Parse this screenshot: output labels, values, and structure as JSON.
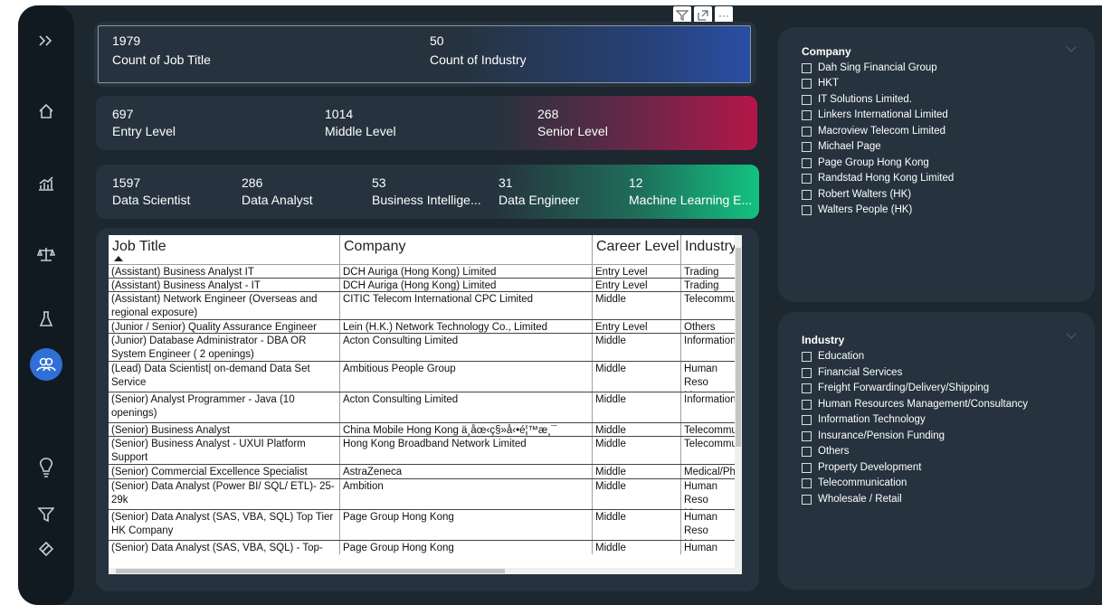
{
  "kpis": {
    "row1": [
      {
        "value": "1979",
        "label": "Count of Job Title"
      },
      {
        "value": "50",
        "label": "Count of Industry"
      }
    ],
    "row2": [
      {
        "value": "697",
        "label": "Entry Level"
      },
      {
        "value": "1014",
        "label": "Middle Level"
      },
      {
        "value": "268",
        "label": "Senior Level"
      }
    ],
    "row3": [
      {
        "value": "1597",
        "label": "Data Scientist"
      },
      {
        "value": "286",
        "label": "Data Analyst"
      },
      {
        "value": "53",
        "label": "Business Intellige..."
      },
      {
        "value": "31",
        "label": "Data Engineer"
      },
      {
        "value": "12",
        "label": "Machine Learning E..."
      }
    ]
  },
  "visual_header": {
    "more_label": "···"
  },
  "table": {
    "headers": [
      "Job Title",
      "Company",
      "Career Level",
      "Industry"
    ],
    "rows": [
      [
        "(Assistant) Business Analyst IT",
        "DCH Auriga (Hong Kong) Limited",
        "Entry Level",
        "Trading and"
      ],
      [
        "(Assistant) Business Analyst - IT",
        "DCH Auriga (Hong Kong) Limited",
        "Entry Level",
        "Trading and"
      ],
      [
        "(Assistant) Network Engineer (Overseas and regional exposure)",
        "CITIC Telecom International CPC Limited",
        "Middle",
        "Telecommu"
      ],
      [
        "(Junior / Senior) Quality Assurance Engineer",
        "Lein (H.K.) Network Technology Co., Limited",
        "Entry Level",
        "Others"
      ],
      [
        "(Junior) Database Administrator - DBA OR System Engineer ( 2 openings)",
        "Acton Consulting Limited",
        "Middle",
        "Information"
      ],
      [
        "(Lead) Data Scientist| on-demand Data Set Service",
        "Ambitious People Group",
        "Middle",
        "Human Reso Manageme"
      ],
      [
        "(Senior) Analyst Programmer - Java (10 openings)",
        "Acton Consulting Limited",
        "Middle",
        "Information"
      ],
      [
        "(Senior) Business Analyst",
        "China Mobile Hong Kong ä¸åœ‹ç§»å‹•é¦™æ¸¯",
        "Middle",
        "Telecommu"
      ],
      [
        "(Senior) Business Analyst - UXUI Platform Support",
        "Hong Kong Broadband Network Limited",
        "Middle",
        "Telecommu"
      ],
      [
        "(Senior) Commercial Excellence Specialist",
        "AstraZeneca",
        "Middle",
        "Medical/Pha"
      ],
      [
        "(Senior) Data Analyst (Power BI/ SQL/ ETL)- 25-29k",
        "Ambition",
        "Middle",
        "Human Reso Manageme"
      ],
      [
        "(Senior) Data Analyst (SAS, VBA, SQL) Top Tier HK Company",
        "Page Group Hong Kong",
        "Middle",
        "Human Reso Manageme"
      ],
      [
        "(Senior) Data Analyst (SAS, VBA, SQL) - Top-",
        "Page Group Hong Kong",
        "Middle",
        "Human Reso"
      ]
    ]
  },
  "slicers": {
    "company": {
      "title": "Company",
      "items": [
        "Dah Sing Financial Group",
        "HKT",
        "IT Solutions Limited.",
        "Linkers International Limited",
        "Macroview Telecom Limited",
        "Michael Page",
        "Page Group Hong Kong",
        "Randstad Hong Kong Limited",
        "Robert Walters (HK)",
        "Walters People (HK)"
      ]
    },
    "industry": {
      "title": "Industry",
      "items": [
        "Education",
        "Financial Services",
        "Freight Forwarding/Delivery/Shipping",
        "Human Resources Management/Consultancy",
        "Information Technology",
        "Insurance/Pension Funding",
        "Others",
        "Property Development",
        "Telecommunication",
        "Wholesale / Retail"
      ]
    }
  },
  "nav": {
    "icons": [
      "expand-icon",
      "home-icon",
      "chart-icon",
      "balance-icon",
      "flask-icon",
      "people-icon",
      "lightbulb-icon",
      "filter-icon",
      "eraser-icon"
    ],
    "active": "people-icon"
  }
}
